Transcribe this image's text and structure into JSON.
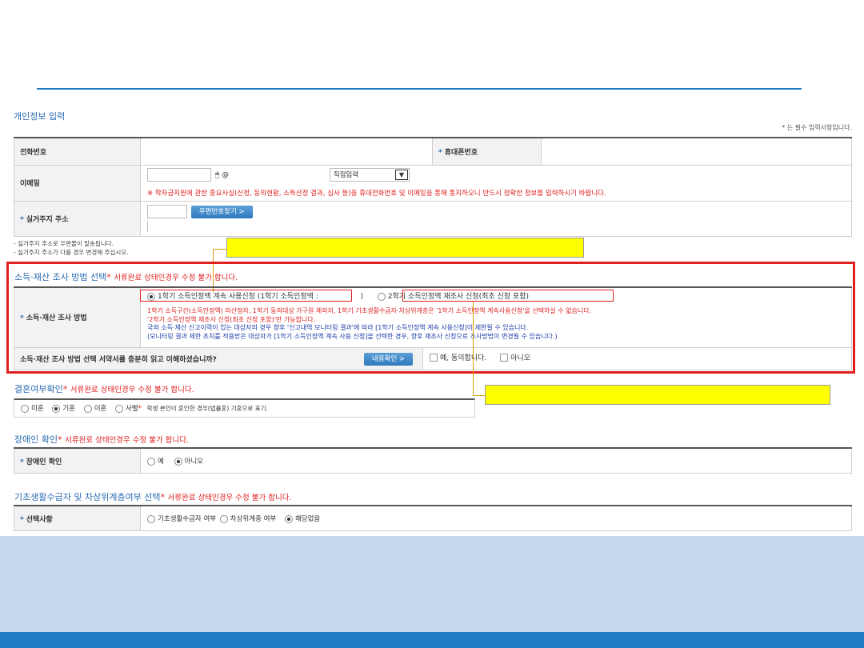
{
  "personal": {
    "title": "개인정보 입력",
    "required_note": "* 는 필수 입력사항입니다.",
    "phone_label": "전화번호",
    "mobile_label": "휴대폰번호",
    "email_label": "이메일",
    "email_at": "@",
    "email_domain_select": "직접입력",
    "email_notice": "※ 학자금지원에 관한 중요사실(신청, 동의현황, 소득산정 결과, 심사 등)을 휴대전화번호 및 이메일을 통해 통지하오니 반드시 정확한 정보를 입력하시기 바랍니다.",
    "address_label": "실거주지 주소",
    "zip_button": "우편번호찾기 >",
    "address_notes": [
      "실거주지 주소로 우편물이 발송됩니다.",
      "실거주지 주소가 다를 경우 변경해 주십시오."
    ]
  },
  "income": {
    "title": "소득·재산 조사 방법 선택",
    "warn": "서류완료 상태인경우 수정 불가 합니다.",
    "row_label": "소득·재산 조사 방법",
    "option1": "1학기 소득인정액 계속 사용신청 (1학기 소득인정액 :",
    "option1_close": ")",
    "option2": "2학기 소득인정액 재조사 신청(최초 신청 포함)",
    "notes_red": [
      "1학기 소득구간(소득인정액) 미산정자, 1학기 동의대상 가구원 제외자, 1학기 기초생활수급자·차상위계층은 '1학기 소득인정액 계속사용신청'을 선택하실 수 없습니다.",
      "'2학기 소득인정액 재조사 신청(최초 신청 포함)'만 가능합니다."
    ],
    "notes_blue": [
      "국외 소득·재산 신고이력이 있는 대상자의 경우 향후 '신고내역 모니터링 결과'에 따라 [1학기 소득인정액 계속 사용신청]이 제한될 수 있습니다.",
      "(모니터링 결과 제한 조치를 적용받은 대상자가 [1학기 소득인정액 계속 사용 신청]을 선택한 경우, 향후 재조사 신청으로 조사방법이 변경될 수 있습니다.)"
    ],
    "consent_question": "소득·재산 조사 방법 선택 서약서를 충분히 읽고 이해하셨습니까?",
    "content_button": "내용확인 >",
    "agree": "예, 동의합니다.",
    "disagree": "아니오"
  },
  "marriage": {
    "title": "결혼여부확인",
    "warn": "서류완료 상태인경우 수정 불가 합니다.",
    "options": [
      "미혼",
      "기혼",
      "이혼",
      "사별"
    ],
    "note": "학생 본인이 혼인한 경우(법률혼) 기혼으로 표기."
  },
  "disability": {
    "title": "장애인 확인",
    "warn": "서류완료 상태인경우 수정 불가 합니다.",
    "row_label": "장애인 확인",
    "options": [
      "예",
      "아니오"
    ]
  },
  "welfare": {
    "title": "기초생활수급자 및 차상위계층여부 선택",
    "warn": "서류완료 상태인경우 수정 불가 합니다.",
    "row_label": "선택사항",
    "options": [
      "기초생활수급자 여부",
      "차상위계층 여부",
      "해당없음"
    ]
  },
  "colors": {
    "accent_blue": "#1e7bc4",
    "highlight_red": "#e02020",
    "callout_yellow": "#ffff00",
    "band": "#c5d9ef"
  }
}
